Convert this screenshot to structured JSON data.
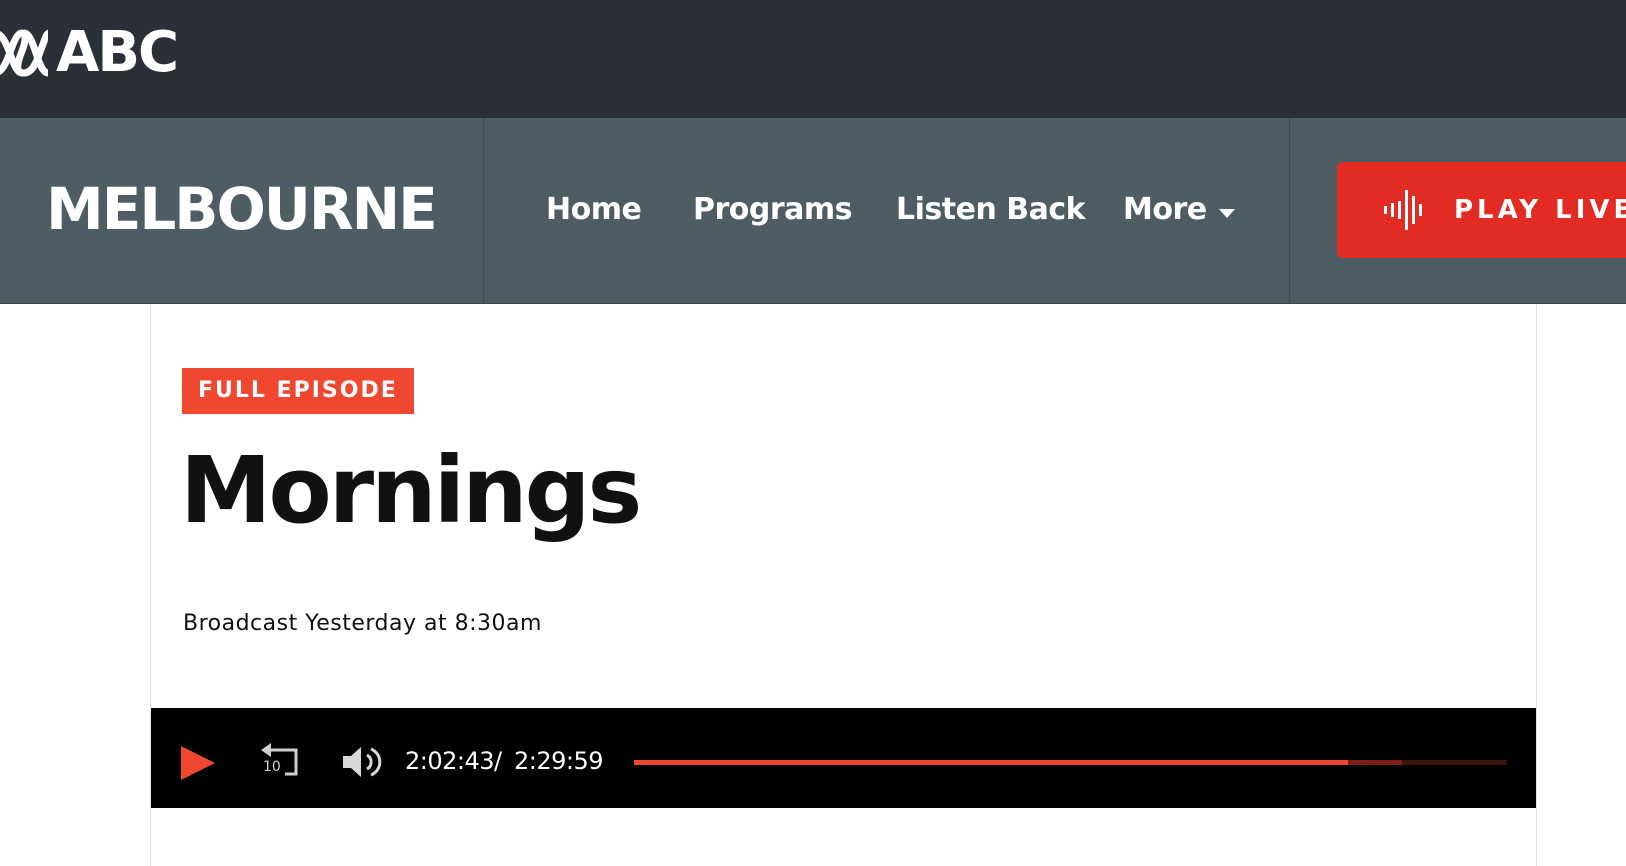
{
  "header": {
    "logo_text": "ABC"
  },
  "nav": {
    "station": "MELBOURNE",
    "items": [
      {
        "label": "Home"
      },
      {
        "label": "Programs"
      },
      {
        "label": "Listen Back"
      },
      {
        "label": "More"
      }
    ],
    "play_live_label": "PLAY LIVE"
  },
  "episode": {
    "badge": "FULL EPISODE",
    "title": "Mornings",
    "broadcast": "Broadcast Yesterday at 8:30am"
  },
  "player": {
    "current_time": "2:02:43",
    "separator": "/",
    "duration": "2:29:59",
    "progress": 0.818,
    "buffered": 0.88,
    "rewind_seconds": "10"
  },
  "colors": {
    "topbar": "#2b3038",
    "navbar": "#4e5c63",
    "accent_red": "#e22b22",
    "badge_red": "#f04830",
    "player_bg": "#000000"
  },
  "icons": [
    "abc-logo-icon",
    "waveform-icon",
    "play-icon",
    "rewind-10-icon",
    "volume-icon",
    "chevron-down-icon"
  ]
}
